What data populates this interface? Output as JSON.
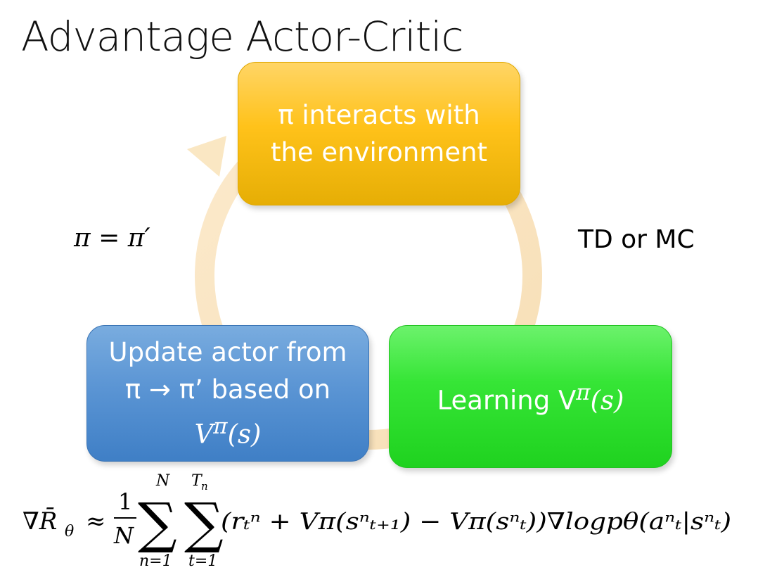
{
  "title": "Advantage Actor-Critic",
  "nodes": {
    "interact": {
      "line1": "π interacts with",
      "line2": "the environment",
      "color": "#ffc21a"
    },
    "learning": {
      "line1": "Learning V",
      "sup": "π",
      "tail": "(s)",
      "color": "#36e536"
    },
    "update": {
      "line1": "Update actor from",
      "line2": "π → π’ based on",
      "line3": "V",
      "sup": "π",
      "tail": "(s)",
      "color": "#5b95d4"
    }
  },
  "edges": {
    "interact_to_learning": "TD or MC",
    "update_to_interact": "π = π′"
  },
  "formula": {
    "lhs": "∇R̄",
    "lhs_sub": "θ",
    "approx": "≈",
    "frac_num": "1",
    "frac_den": "N",
    "sum1_top": "N",
    "sum1_bottom": "n=1",
    "sum2_top": "T",
    "sum2_top_sub": "n",
    "sum2_bottom": "t=1",
    "body": "(rₜⁿ + Vπ(sⁿₜ₊₁) − Vπ(sⁿₜ))∇logpθ(aⁿₜ|sⁿₜ)"
  },
  "colors": {
    "arrow": "#f9dfb4"
  }
}
